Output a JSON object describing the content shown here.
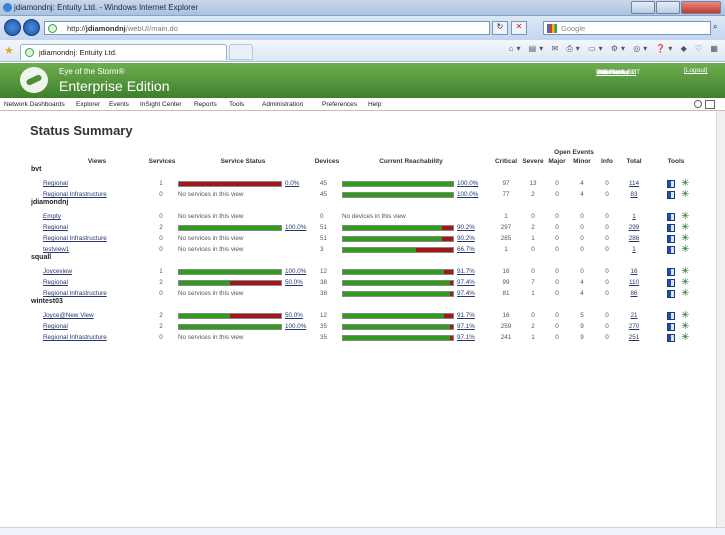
{
  "window": {
    "title": "jdiamondnj: Entuity Ltd. - Windows Internet Explorer"
  },
  "browser": {
    "url_prefix": "http://",
    "url_host": "jdiamondnj",
    "url_path": "/webUI/main.do",
    "search_placeholder": "Google",
    "tab_label": "jdiamondnj: Entuity Ltd."
  },
  "banner": {
    "line1": "Eye of the Storm®",
    "line2": "Enterprise Edition",
    "username_label": "Username",
    "username": ":admin",
    "server_label": "EYE Server",
    "server": ":jdiamondnj",
    "page_updated_label": "Page Updated",
    "page_updated": ": 10:14:40, EDT",
    "logout": "[Logout]"
  },
  "menu": [
    "Network Dashboards",
    "Explorer",
    "Events",
    "InSight Center",
    "Reports",
    "Tools",
    "Administration",
    "Preferences",
    "Help"
  ],
  "page": {
    "title": "Status Summary"
  },
  "headers": {
    "views": "Views",
    "services": "Services",
    "service_status": "Service Status",
    "devices": "Devices",
    "current_reachability": "Current Reachability",
    "open_events": "Open Events",
    "critical": "Critical",
    "severe": "Severe",
    "major": "Major",
    "minor": "Minor",
    "info": "Info",
    "total": "Total",
    "tools": "Tools"
  },
  "no_services_text": "No services in this view",
  "no_devices_text": "No devices in this view",
  "groups": [
    {
      "name": "bvt",
      "rows": [
        {
          "view": "Regional",
          "services": "1",
          "svc_pct": "0.0%",
          "svc_fill": 0.0,
          "devices": "45",
          "reach_pct": "100.0%",
          "reach_fill": 1.0,
          "critical": "97",
          "severe": "13",
          "major": "0",
          "minor": "4",
          "info": "0",
          "total": "114"
        },
        {
          "view": "Regional Infrastructure",
          "services": "0",
          "svc_pct": "",
          "svc_fill": null,
          "devices": "45",
          "reach_pct": "100.0%",
          "reach_fill": 1.0,
          "critical": "77",
          "severe": "2",
          "major": "0",
          "minor": "4",
          "info": "0",
          "total": "83"
        }
      ]
    },
    {
      "name": "jdiamondnj",
      "rows": [
        {
          "view": "Empty",
          "services": "0",
          "svc_pct": "",
          "svc_fill": null,
          "devices": "0",
          "reach_pct": "",
          "reach_fill": null,
          "critical": "1",
          "severe": "0",
          "major": "0",
          "minor": "0",
          "info": "0",
          "total": "1"
        },
        {
          "view": "Regional",
          "services": "2",
          "svc_pct": "100.0%",
          "svc_fill": 1.0,
          "devices": "51",
          "reach_pct": "90.2%",
          "reach_fill": 0.902,
          "critical": "297",
          "severe": "2",
          "major": "0",
          "minor": "0",
          "info": "0",
          "total": "299"
        },
        {
          "view": "Regional Infrastructure",
          "services": "0",
          "svc_pct": "",
          "svc_fill": null,
          "devices": "51",
          "reach_pct": "90.2%",
          "reach_fill": 0.902,
          "critical": "285",
          "severe": "1",
          "major": "0",
          "minor": "0",
          "info": "0",
          "total": "286"
        },
        {
          "view": "testview1",
          "services": "0",
          "svc_pct": "",
          "svc_fill": null,
          "devices": "3",
          "reach_pct": "66.7%",
          "reach_fill": 0.667,
          "critical": "1",
          "severe": "0",
          "major": "0",
          "minor": "0",
          "info": "0",
          "total": "1"
        }
      ]
    },
    {
      "name": "squall",
      "rows": [
        {
          "view": "Joyceview",
          "services": "1",
          "svc_pct": "100.0%",
          "svc_fill": 1.0,
          "devices": "12",
          "reach_pct": "91.7%",
          "reach_fill": 0.917,
          "critical": "16",
          "severe": "0",
          "major": "0",
          "minor": "0",
          "info": "0",
          "total": "16"
        },
        {
          "view": "Regional",
          "services": "2",
          "svc_pct": "50.0%",
          "svc_fill": 0.5,
          "devices": "38",
          "reach_pct": "97.4%",
          "reach_fill": 0.974,
          "critical": "99",
          "severe": "7",
          "major": "0",
          "minor": "4",
          "info": "0",
          "total": "110"
        },
        {
          "view": "Regional Infrastructure",
          "services": "0",
          "svc_pct": "",
          "svc_fill": null,
          "devices": "38",
          "reach_pct": "97.4%",
          "reach_fill": 0.974,
          "critical": "81",
          "severe": "1",
          "major": "0",
          "minor": "4",
          "info": "0",
          "total": "86"
        }
      ]
    },
    {
      "name": "wintest03",
      "rows": [
        {
          "view": "Joyce@New View",
          "services": "2",
          "svc_pct": "50.0%",
          "svc_fill": 0.5,
          "devices": "12",
          "reach_pct": "91.7%",
          "reach_fill": 0.917,
          "critical": "16",
          "severe": "0",
          "major": "0",
          "minor": "5",
          "info": "0",
          "total": "21"
        },
        {
          "view": "Regional",
          "services": "2",
          "svc_pct": "100.0%",
          "svc_fill": 1.0,
          "devices": "35",
          "reach_pct": "97.1%",
          "reach_fill": 0.971,
          "critical": "259",
          "severe": "2",
          "major": "0",
          "minor": "9",
          "info": "0",
          "total": "270"
        },
        {
          "view": "Regional Infrastructure",
          "services": "0",
          "svc_pct": "",
          "svc_fill": null,
          "devices": "35",
          "reach_pct": "97.1%",
          "reach_fill": 0.971,
          "critical": "241",
          "severe": "1",
          "major": "0",
          "minor": "9",
          "info": "0",
          "total": "251"
        }
      ]
    }
  ],
  "colors": {
    "ok": "#2e9d1a",
    "bad": "#a3161a",
    "banner": "#4c8e36",
    "link": "#28376b"
  }
}
